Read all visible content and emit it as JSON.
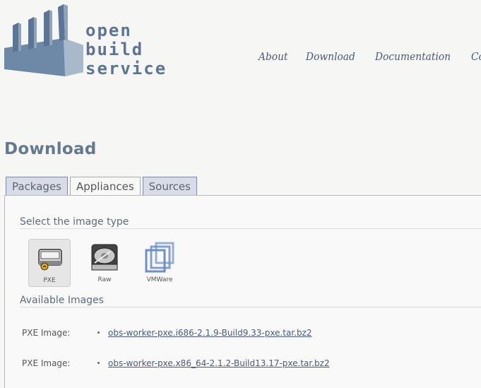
{
  "header": {
    "logo_lines": [
      "open",
      "build",
      "service"
    ],
    "nav": [
      "About",
      "Download",
      "Documentation",
      "Con"
    ]
  },
  "page_title": "Download",
  "tabs": [
    {
      "label": "Packages",
      "active": false
    },
    {
      "label": "Appliances",
      "active": true
    },
    {
      "label": "Sources",
      "active": false
    }
  ],
  "select_section": {
    "title": "Select the image type",
    "types": [
      {
        "label": "PXE",
        "icon": "network-drive-icon",
        "selected": true
      },
      {
        "label": "Raw",
        "icon": "hard-disk-icon",
        "selected": false
      },
      {
        "label": "VMWare",
        "icon": "vmware-icon",
        "selected": false
      }
    ]
  },
  "images_section": {
    "title": "Available Images",
    "rows": [
      {
        "label": "PXE Image:",
        "link": "obs-worker-pxe.i686-2.1.9-Build9.33-pxe.tar.bz2"
      },
      {
        "label": "PXE Image:",
        "link": "obs-worker-pxe.x86_64-2.1.2-Build13.17-pxe.tar.bz2"
      }
    ]
  },
  "colors": {
    "logo": "#5c7594",
    "tab_inactive": "#d9dbe6",
    "link": "#4a5a7a"
  }
}
